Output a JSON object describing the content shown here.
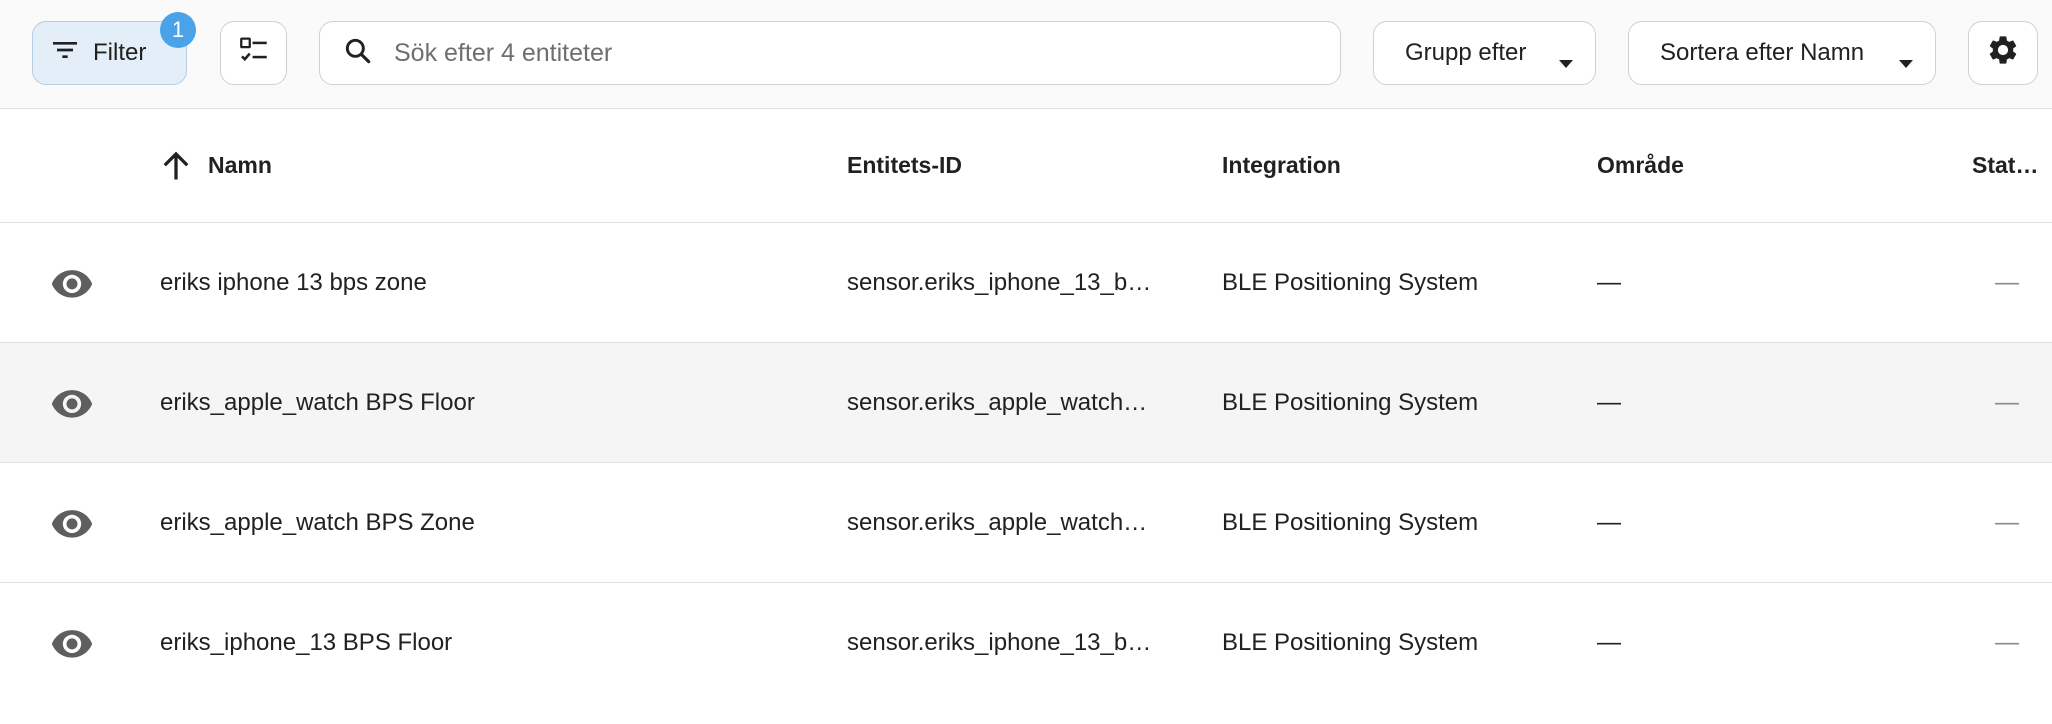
{
  "toolbar": {
    "filter_label": "Filter",
    "filter_badge": "1",
    "search_placeholder": "Sök efter 4 entiteter",
    "group_label": "Grupp efter",
    "sort_label": "Sortera efter Namn"
  },
  "columns": {
    "name": "Namn",
    "entity_id": "Entitets-ID",
    "integration": "Integration",
    "area": "Område",
    "status": "Stat…"
  },
  "rows": [
    {
      "name": "eriks iphone 13 bps zone",
      "entity_id": "sensor.eriks_iphone_13_b…",
      "integration": "BLE Positioning System",
      "area": "—",
      "status": "—"
    },
    {
      "name": "eriks_apple_watch BPS Floor",
      "entity_id": "sensor.eriks_apple_watch…",
      "integration": "BLE Positioning System",
      "area": "—",
      "status": "—"
    },
    {
      "name": "eriks_apple_watch BPS Zone",
      "entity_id": "sensor.eriks_apple_watch…",
      "integration": "BLE Positioning System",
      "area": "—",
      "status": "—"
    },
    {
      "name": "eriks_iphone_13 BPS Floor",
      "entity_id": "sensor.eriks_iphone_13_b…",
      "integration": "BLE Positioning System",
      "area": "—",
      "status": "—"
    }
  ],
  "colors": {
    "filter_bg": "#e3eef8",
    "badge": "#4aa3e8",
    "icon": "#5f5f5f",
    "hover_row": "#f5f5f5"
  },
  "icons": {
    "filter": "filter-icon",
    "select": "checklist-icon",
    "search": "search-icon",
    "caret": "caret-down-icon",
    "settings": "gear-icon",
    "sort": "arrow-up-icon",
    "visibility": "eye-icon"
  }
}
